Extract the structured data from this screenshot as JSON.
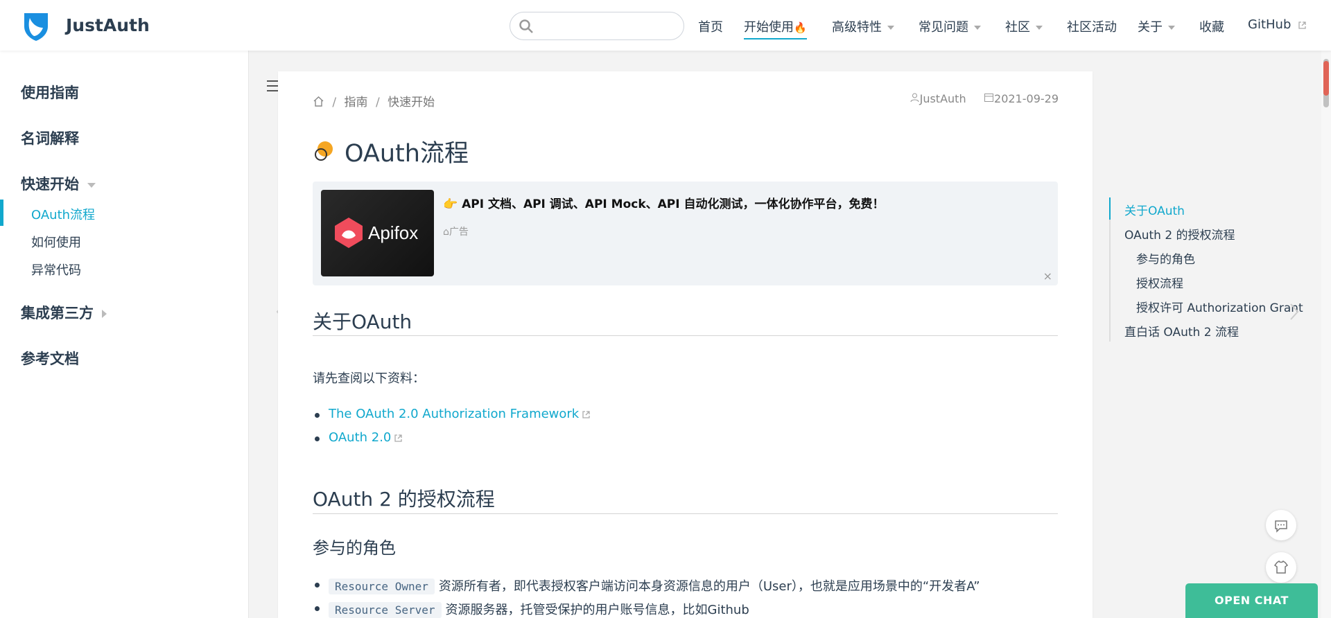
{
  "navbar": {
    "brand": "JustAuth",
    "search_placeholder": "",
    "items": [
      {
        "label": "首页"
      },
      {
        "label": "开始使用",
        "badge": "🔥"
      },
      {
        "label": "高级特性"
      },
      {
        "label": "常见问题"
      },
      {
        "label": "社区"
      },
      {
        "label": "社区活动"
      },
      {
        "label": "关于"
      },
      {
        "label": "收藏"
      },
      {
        "label": "GitHub"
      }
    ]
  },
  "sidebar": {
    "groups": [
      {
        "label": "使用指南"
      },
      {
        "label": "名词解释"
      },
      {
        "label": "快速开始"
      },
      {
        "label": "集成第三方"
      },
      {
        "label": "参考文档"
      }
    ],
    "items": [
      {
        "label": "OAuth流程"
      },
      {
        "label": "如何使用"
      },
      {
        "label": "异常代码"
      }
    ]
  },
  "breadcrumb": {
    "items": [
      "指南",
      "快速开始"
    ],
    "separator": "/"
  },
  "meta": {
    "author": "JustAuth",
    "date": "2021-09-29"
  },
  "page": {
    "title": "OAuth流程"
  },
  "ad": {
    "brand": "Apifox",
    "text": "👉 API 文档、API 调试、API Mock、API 自动化测试，一体化协作平台，免费！",
    "tag": "广告",
    "close": "×"
  },
  "sections": {
    "about_title": "关于OAuth",
    "about_intro": "请先查阅以下资料：",
    "links": [
      "The OAuth 2.0 Authorization Framework",
      "OAuth 2.0"
    ],
    "flow_title": "OAuth 2 的授权流程",
    "roles_title": "参与的角色",
    "roles": [
      {
        "code": "Resource Owner",
        "text": "资源所有者，即代表授权客户端访问本身资源信息的用户（User），也就是应用场景中的“开发者A”"
      },
      {
        "code": "Resource Server",
        "text": "资源服务器，托管受保护的用户账号信息，比如Github"
      }
    ]
  },
  "toc": {
    "items": [
      {
        "label": "关于OAuth"
      },
      {
        "label": "OAuth 2 的授权流程"
      },
      {
        "label": "参与的角色"
      },
      {
        "label": "授权流程"
      },
      {
        "label": "授权许可 Authorization Grant"
      },
      {
        "label": "直白话 OAuth 2 流程"
      }
    ]
  },
  "chat": {
    "label": "OPEN CHAT"
  },
  "colors": {
    "accent": "#11a8cd",
    "chat": "#3ebd98",
    "text": "#2c3e50"
  }
}
